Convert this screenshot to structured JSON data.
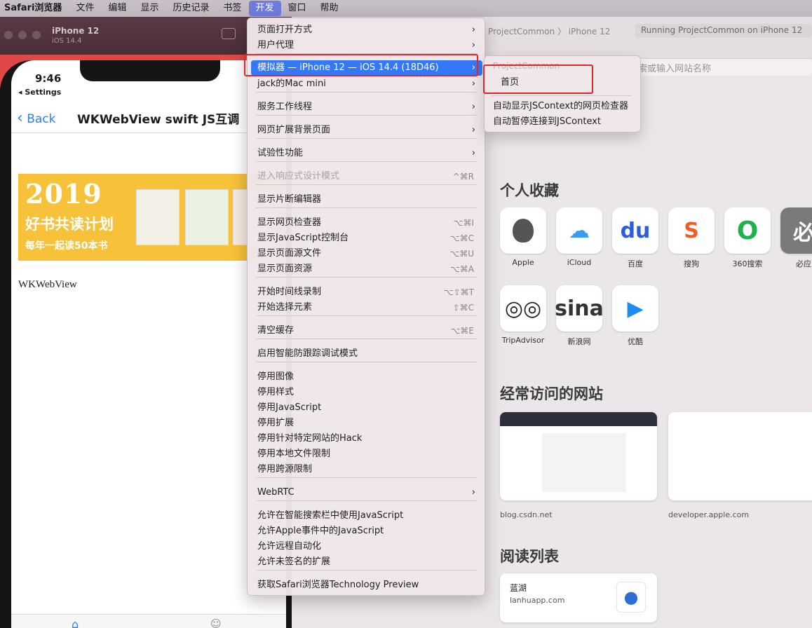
{
  "menubar": {
    "items": [
      "Safari浏览器",
      "文件",
      "编辑",
      "显示",
      "历史记录",
      "书签",
      "开发",
      "窗口",
      "帮助"
    ]
  },
  "simulator": {
    "device_name": "iPhone 12",
    "os_version": "iOS 14.4",
    "time": "9:46",
    "back_to_app": "◂ Settings",
    "nav_back": "Back",
    "nav_title": "WKWebView swift JS互调",
    "banner": {
      "year": "2019",
      "line1": "好书共读计划",
      "line2": "每年一起读50本书"
    },
    "body_text": "WKWebView"
  },
  "safari": {
    "breadcrumb": [
      "ProjectCommon",
      "iPhone 12"
    ],
    "status": "Running ProjectCommon on iPhone 12",
    "url_placeholder": "索或输入网站名称",
    "favorites_title": "个人收藏",
    "favorites": [
      {
        "label": "Apple",
        "icon": "apple-icon",
        "glyph": "",
        "color": "#555555"
      },
      {
        "label": "iCloud",
        "icon": "cloud-icon",
        "glyph": "☁",
        "color": "#3a9bf0"
      },
      {
        "label": "百度",
        "icon": "paw-icon",
        "glyph": "du",
        "color": "#2b5ed8"
      },
      {
        "label": "搜狗",
        "icon": "sogou-icon",
        "glyph": "S",
        "color": "#f25b22"
      },
      {
        "label": "360搜索",
        "icon": "ring-icon",
        "glyph": "O",
        "color": "#20b14b"
      },
      {
        "label": "必应",
        "icon": "bing-icon",
        "glyph": "必",
        "color": "#ffffff"
      },
      {
        "label": "TripAdvisor",
        "icon": "owl-icon",
        "glyph": "◎◎",
        "color": "#222222"
      },
      {
        "label": "新浪网",
        "icon": "sina-icon",
        "glyph": "sina",
        "color": "#333333"
      },
      {
        "label": "优酷",
        "icon": "play-icon",
        "glyph": "▶",
        "color": "#1c8cf0"
      }
    ],
    "frequent_title": "经常访问的网站",
    "frequent": [
      {
        "label": "blog.csdn.net"
      },
      {
        "label": "developer.apple.com"
      }
    ],
    "reading_title": "阅读列表",
    "reading": {
      "title": "蓝湖",
      "url": "lanhuapp.com"
    }
  },
  "develop_menu": {
    "items": [
      {
        "label": "页面打开方式",
        "chevron": "›"
      },
      {
        "label": "用户代理",
        "chevron": "›"
      },
      {
        "label": "模拟器 — iPhone 12 — iOS 14.4 (18D46)",
        "chevron": "›"
      },
      {
        "label": "jack的Mac mini",
        "chevron": "›"
      },
      {
        "label": "服务工作线程",
        "chevron": "›"
      },
      {
        "label": "网页扩展背景页面",
        "chevron": "›"
      },
      {
        "label": "试验性功能",
        "chevron": "›"
      },
      {
        "label": "进入响应式设计模式",
        "shortcut": "^⌘R"
      },
      {
        "label": "显示片断编辑器"
      },
      {
        "label": "显示网页检查器",
        "shortcut": "⌥⌘I"
      },
      {
        "label": "显示JavaScript控制台",
        "shortcut": "⌥⌘C"
      },
      {
        "label": "显示页面源文件",
        "shortcut": "⌥⌘U"
      },
      {
        "label": "显示页面资源",
        "shortcut": "⌥⌘A"
      },
      {
        "label": "开始时间线录制",
        "shortcut": "⌥⇧⌘T"
      },
      {
        "label": "开始选择元素",
        "shortcut": "⇧⌘C"
      },
      {
        "label": "清空缓存",
        "shortcut": "⌥⌘E"
      },
      {
        "label": "启用智能防跟踪调试模式"
      },
      {
        "label": "停用图像"
      },
      {
        "label": "停用样式"
      },
      {
        "label": "停用JavaScript"
      },
      {
        "label": "停用扩展"
      },
      {
        "label": "停用针对特定网站的Hack"
      },
      {
        "label": "停用本地文件限制"
      },
      {
        "label": "停用跨源限制"
      },
      {
        "label": "WebRTC",
        "chevron": "›"
      },
      {
        "label": "允许在智能搜索栏中使用JavaScript"
      },
      {
        "label": "允许Apple事件中的JavaScript"
      },
      {
        "label": "允许远程自动化"
      },
      {
        "label": "允许未签名的扩展"
      },
      {
        "label": "获取Safari浏览器Technology Preview"
      }
    ]
  },
  "simulator_submenu": {
    "header": "ProjectCommon",
    "items": [
      "首页",
      "自动显示JSContext的网页检查器",
      "自动暂停连接到JSContext"
    ]
  }
}
